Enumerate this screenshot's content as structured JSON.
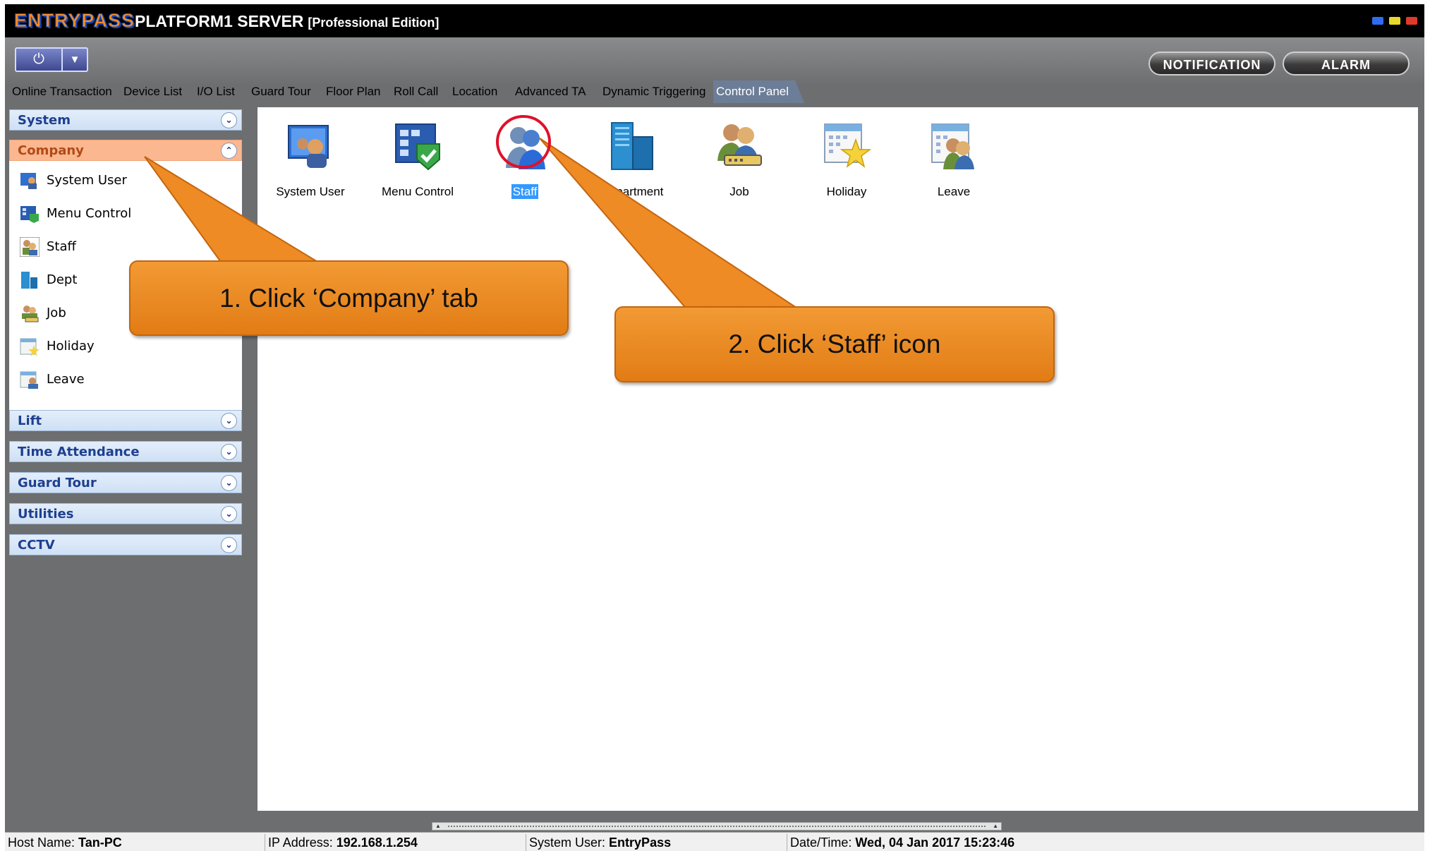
{
  "window": {
    "logo": "ENTRYPASS",
    "title": "PLATFORM1 SERVER",
    "edition": "[Professional Edition]",
    "controls": [
      "minimize",
      "maximize",
      "close"
    ],
    "control_colors": [
      "#2f6df0",
      "#e8d82a",
      "#e03a2a"
    ]
  },
  "toolbar": {
    "power_icon": "power-icon",
    "dropdown_icon": "caret-down-icon",
    "notification_label": "NOTIFICATION",
    "alarm_label": "ALARM"
  },
  "tabs": [
    {
      "label": "Online Transaction"
    },
    {
      "label": "Device List"
    },
    {
      "label": "I/O List"
    },
    {
      "label": "Guard Tour"
    },
    {
      "label": "Floor Plan"
    },
    {
      "label": "Roll Call"
    },
    {
      "label": "Location"
    },
    {
      "label": "Advanced TA"
    },
    {
      "label": "Dynamic Triggering"
    },
    {
      "label": "Control Panel",
      "active": true
    }
  ],
  "sidebar": {
    "sections": [
      {
        "label": "System"
      },
      {
        "label": "Company",
        "expanded": true
      },
      {
        "label": "Lift"
      },
      {
        "label": "Time Attendance"
      },
      {
        "label": "Guard Tour"
      },
      {
        "label": "Utilities"
      },
      {
        "label": "CCTV"
      }
    ],
    "company_items": [
      {
        "label": "System User",
        "icon": "system-user-icon"
      },
      {
        "label": "Menu Control",
        "icon": "menu-control-icon"
      },
      {
        "label": "Staff",
        "icon": "staff-icon",
        "selected": true
      },
      {
        "label": "Dept",
        "icon": "department-icon"
      },
      {
        "label": "Job",
        "icon": "job-icon"
      },
      {
        "label": "Holiday",
        "icon": "holiday-icon"
      },
      {
        "label": "Leave",
        "icon": "leave-icon"
      }
    ]
  },
  "content": {
    "icons": [
      {
        "label": "System User",
        "icon": "system-user-icon"
      },
      {
        "label": "Menu Control",
        "icon": "menu-control-icon"
      },
      {
        "label": "Staff",
        "icon": "staff-icon",
        "selected": true
      },
      {
        "label": "Department",
        "icon": "department-icon"
      },
      {
        "label": "Job",
        "icon": "job-icon"
      },
      {
        "label": "Holiday",
        "icon": "holiday-icon"
      },
      {
        "label": "Leave",
        "icon": "leave-icon"
      }
    ]
  },
  "callouts": {
    "step1": "1. Click ‘Company’ tab",
    "step2": "2. Click ‘Staff’ icon"
  },
  "status": {
    "host_label": "Host Name:",
    "host_value": "Tan-PC",
    "ip_label": "IP Address:",
    "ip_value": "192.168.1.254",
    "user_label": "System User:",
    "user_value": "EntryPass",
    "datetime_label": "Date/Time:",
    "datetime_value": "Wed, 04 Jan 2017 15:23:46"
  },
  "colors": {
    "accent_orange": "#f08a24",
    "highlight_red": "#e0102a",
    "selection_blue": "#3399ff",
    "section_header_blue": "#1e3f8f"
  }
}
